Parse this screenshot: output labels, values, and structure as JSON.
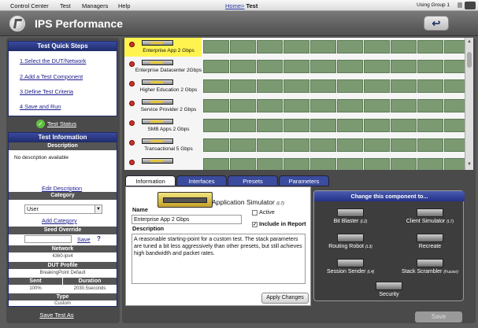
{
  "menu": {
    "items": [
      "Control Center",
      "Test",
      "Managers",
      "Help"
    ],
    "crumb_home": "Home>",
    "crumb_current": "Test",
    "group": "Using Group 1"
  },
  "title": "IPS Performance",
  "quick_steps": {
    "header": "Test Quick Steps",
    "steps": [
      "1.Select the DUT/Network",
      "2.Add a Test Component",
      "3.Define Test Criteria",
      "4.Save and Run"
    ],
    "status": "Test Status"
  },
  "test_info": {
    "header": "Test Information",
    "desc_label": "Description",
    "desc_text": "No description available",
    "edit_desc": "Edit Description",
    "category_label": "Category",
    "category_value": "User",
    "add_category": "Add Category",
    "seed_label": "Seed Override",
    "seed_save": "Save",
    "seed_help": "?",
    "network_label": "Network",
    "network_value": "4360-ipv4",
    "dut_label": "DUT Profile",
    "dut_value": "BreakingPoint Default",
    "sent_label": "Sent",
    "duration_label": "Duration",
    "sent_value": "100%",
    "duration_value": "2030.5seconds",
    "type_label": "Type",
    "type_value": "Custom"
  },
  "save_test_as": "Save Test As",
  "components": [
    {
      "label": "Enterprise App 2 Gbps",
      "active": true
    },
    {
      "label": "Enterprise Datacenter 2Gbps",
      "active": false
    },
    {
      "label": "Higher Education 2 Gbps",
      "active": false
    },
    {
      "label": "Service Provider 2 Gbps",
      "active": false
    },
    {
      "label": "SMB Apps 2 Gbps",
      "active": false
    },
    {
      "label": "Transactional 5 Gbps",
      "active": false
    },
    {
      "label": "",
      "active": false
    }
  ],
  "tabs": [
    "Information",
    "Interfaces",
    "Presets",
    "Parameters"
  ],
  "information": {
    "app_name": "Application Simulator",
    "app_layer": "(L7)",
    "name_label": "Name",
    "name_value": "Enterprise App 2 Gbps",
    "active_label": "Active",
    "include_label": "Include in Report",
    "description_label": "Description",
    "description_text": "A reasonable starting-point for a custom test. The stack parameters are tuned a bit less aggressively than other presets, but still achieves high bandwidth and packet rates.",
    "apply": "Apply Changes"
  },
  "change_component": {
    "header": "Change this component to...",
    "items": [
      {
        "label": "Bit Blaster",
        "layer": "(L2)"
      },
      {
        "label": "Client Simulator",
        "layer": "(L7)"
      },
      {
        "label": "Routing Robot",
        "layer": "(L3)"
      },
      {
        "label": "Recreate",
        "layer": ""
      },
      {
        "label": "Session Sender",
        "layer": "(L4)"
      },
      {
        "label": "Stack Scrambler",
        "layer": "(Fuzzer)"
      },
      {
        "label": "Security",
        "layer": ""
      }
    ]
  },
  "save": "Save"
}
